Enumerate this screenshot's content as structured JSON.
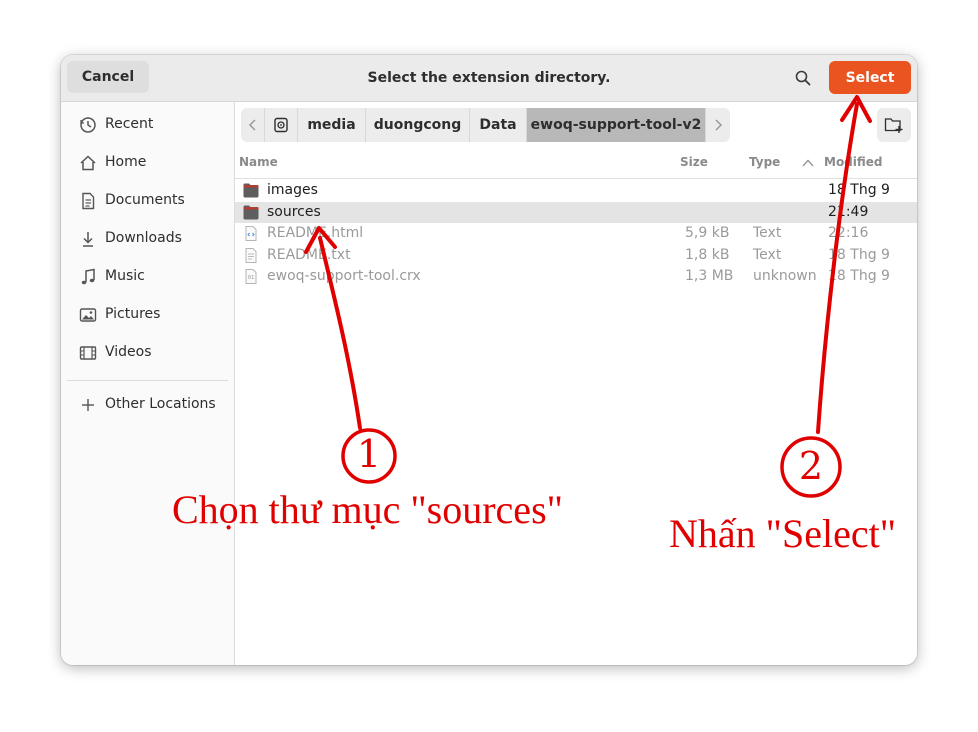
{
  "header": {
    "cancel_label": "Cancel",
    "title": "Select the extension directory.",
    "search_icon": "search-icon",
    "select_label": "Select",
    "accent_color": "#e95420"
  },
  "sidebar": {
    "items": [
      {
        "label": "Recent",
        "icon": "clock-icon"
      },
      {
        "label": "Home",
        "icon": "home-icon"
      },
      {
        "label": "Documents",
        "icon": "document-icon"
      },
      {
        "label": "Downloads",
        "icon": "download-icon"
      },
      {
        "label": "Music",
        "icon": "music-icon"
      },
      {
        "label": "Pictures",
        "icon": "picture-icon"
      },
      {
        "label": "Videos",
        "icon": "video-icon"
      }
    ],
    "other_locations": {
      "label": "Other Locations",
      "icon": "plus-icon"
    }
  },
  "pathbar": {
    "crumbs": [
      "media",
      "duongcong",
      "Data",
      "ewoq-support-tool-v2"
    ],
    "active": "ewoq-support-tool-v2"
  },
  "columns": {
    "name": "Name",
    "size": "Size",
    "type": "Type",
    "modified": "Modified"
  },
  "files": [
    {
      "name": "images",
      "size": "",
      "type": "",
      "modified": "18 Thg 9",
      "kind": "folder"
    },
    {
      "name": "sources",
      "size": "",
      "type": "",
      "modified": "21:49",
      "kind": "folder",
      "selected": true
    },
    {
      "name": "README.html",
      "size": "5,9 kB",
      "type": "Text",
      "modified": "22:16",
      "kind": "html"
    },
    {
      "name": "README.txt",
      "size": "1,8 kB",
      "type": "Text",
      "modified": "18 Thg 9",
      "kind": "text"
    },
    {
      "name": "ewoq-support-tool.crx",
      "size": "1,3 MB",
      "type": "unknown",
      "modified": "18 Thg 9",
      "kind": "binary"
    }
  ],
  "annotations": {
    "step1_number": "1",
    "step1_text": "Chọn thư mục \"sources\"",
    "step2_number": "2",
    "step2_text": "Nhấn \"Select\"",
    "color": "#e00000"
  }
}
